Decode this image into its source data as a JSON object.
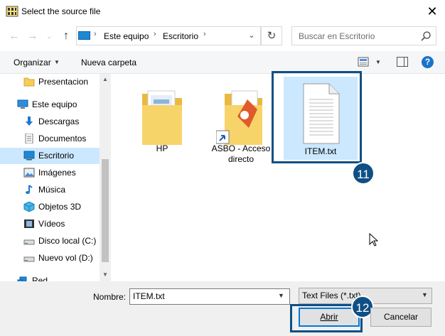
{
  "window": {
    "title": "Select the source file",
    "close_glyph": "✕"
  },
  "nav": {
    "back_glyph": "←",
    "forward_glyph": "→",
    "recent_glyph": "⌄",
    "up_glyph": "↑",
    "address": {
      "crumbs": [
        "Este equipo",
        "Escritorio"
      ],
      "separator": "›"
    },
    "refresh_glyph": "↻",
    "search_placeholder": "Buscar en Escritorio"
  },
  "toolbar": {
    "organize_label": "Organizar",
    "new_folder_label": "Nueva carpeta",
    "help_label": "?"
  },
  "sidebar": {
    "items": [
      {
        "label": "Presentacion",
        "icon": "folder-icon"
      },
      {
        "label": "Este equipo",
        "icon": "computer-icon"
      },
      {
        "label": "Descargas",
        "icon": "download-arrow-icon"
      },
      {
        "label": "Documentos",
        "icon": "document-icon"
      },
      {
        "label": "Escritorio",
        "icon": "desktop-icon",
        "selected": true
      },
      {
        "label": "Imágenes",
        "icon": "pictures-icon"
      },
      {
        "label": "Música",
        "icon": "music-note-icon"
      },
      {
        "label": "Objetos 3D",
        "icon": "cube-icon"
      },
      {
        "label": "Vídeos",
        "icon": "video-icon"
      },
      {
        "label": "Disco local (C:)",
        "icon": "drive-icon"
      },
      {
        "label": "Nuevo vol (D:)",
        "icon": "drive-icon"
      },
      {
        "label": "Red",
        "icon": "network-icon"
      }
    ]
  },
  "files": [
    {
      "name": "HP",
      "type": "folder-icon"
    },
    {
      "name": "ASBO - Acceso directo",
      "type": "shortcut-folder-icon"
    },
    {
      "name": "ITEM.txt",
      "type": "text-file-icon",
      "selected": true
    }
  ],
  "bottom": {
    "filename_label": "Nombre:",
    "filename_value": "ITEM.txt",
    "filetype_value": "Text Files (*.txt)",
    "open_label": "Abrir",
    "cancel_label": "Cancelar"
  },
  "annotations": {
    "step_a": "11",
    "step_b": "12"
  },
  "colors": {
    "accent": "#0078d7",
    "selection": "#cce8ff",
    "annotation": "#0f4f86",
    "folder": "#f5cd5b"
  }
}
